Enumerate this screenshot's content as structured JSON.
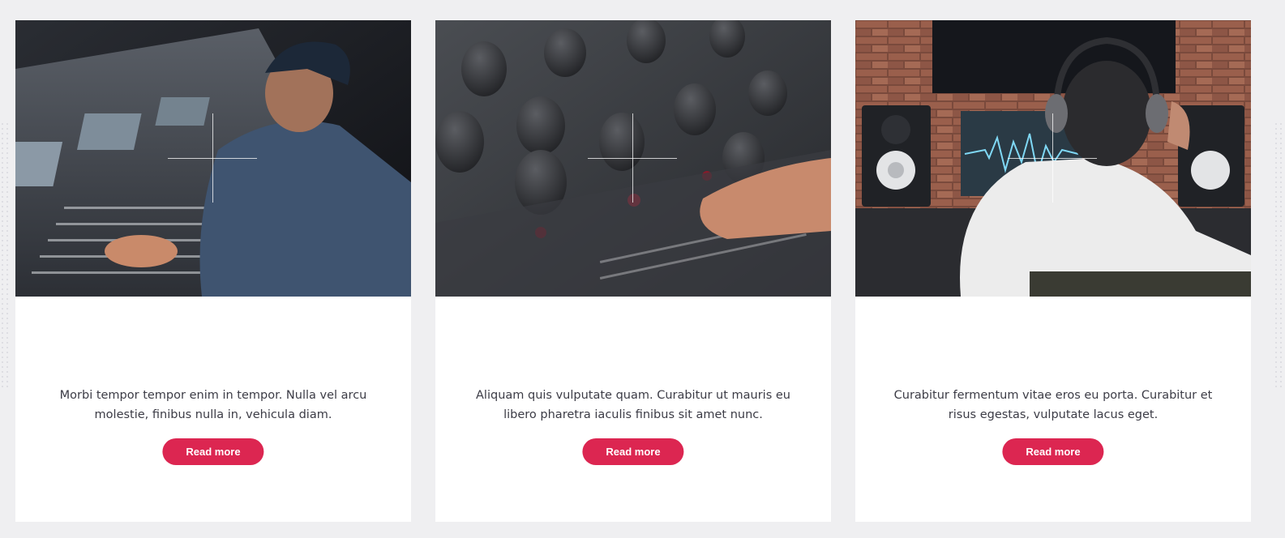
{
  "cards": [
    {
      "image": "person-at-mixing-console",
      "text": "Morbi tempor tempor enim in tempor. Nulla vel arcu molestie, finibus nulla in, vehicula diam.",
      "button_label": "Read more"
    },
    {
      "image": "audio-mixer-knobs-closeup",
      "text": "Aliquam quis vulputate quam. Curabitur ut mauris eu libero pharetra iaculis finibus sit amet nunc.",
      "button_label": "Read more"
    },
    {
      "image": "man-with-headphones-in-studio",
      "text": "Curabitur fermentum vitae eros eu porta. Curabitur et risus egestas, vulputate lacus eget.",
      "button_label": "Read more"
    }
  ],
  "colors": {
    "accent": "#dc2651",
    "background": "#efeff1",
    "card": "#ffffff",
    "text": "#3c3c46"
  }
}
